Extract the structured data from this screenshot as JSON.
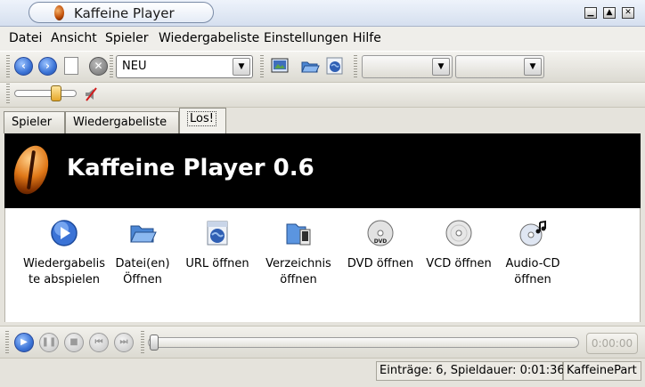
{
  "window": {
    "title": "Kaffeine Player"
  },
  "menu": [
    "Datei",
    "Ansicht",
    "Spieler",
    "Wiedergabeliste",
    "Einstellungen",
    "Hilfe"
  ],
  "toolbar": {
    "combo_value": "NEU"
  },
  "tabs": [
    "Spieler",
    "Wiedergabeliste",
    "Los!"
  ],
  "banner": {
    "title": "Kaffeine Player 0.6"
  },
  "actions": [
    {
      "label": "Wiedergabelis\nte abspielen",
      "icon": "play-circle-icon"
    },
    {
      "label": "Datei(en)\nÖffnen",
      "icon": "folder-open-icon"
    },
    {
      "label": "URL öffnen",
      "icon": "globe-icon"
    },
    {
      "label": "Verzeichnis\nöffnen",
      "icon": "directory-icon"
    },
    {
      "label": "DVD öffnen",
      "icon": "dvd-icon"
    },
    {
      "label": "VCD öffnen",
      "icon": "vcd-icon"
    },
    {
      "label": "Audio-CD\nöffnen",
      "icon": "audio-cd-icon"
    }
  ],
  "player": {
    "time": "0:00:00"
  },
  "status": {
    "entries": "Einträge: 6, Spieldauer: 0:01:36",
    "part": "KaffeinePart"
  }
}
